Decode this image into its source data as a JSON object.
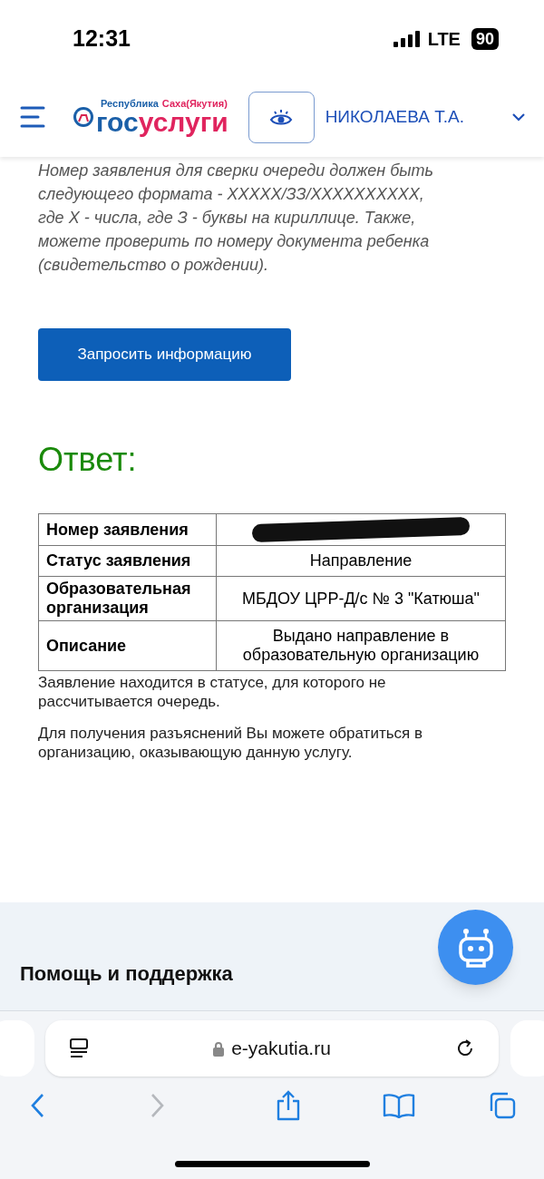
{
  "status_bar": {
    "time": "12:31",
    "network": "LTE",
    "battery": "90"
  },
  "header": {
    "brand_top_left": "Республика",
    "brand_top_right": "Саха(Якутия)",
    "brand_left": "гос",
    "brand_right": "услуги",
    "user": "НИКОЛАЕВА Т.А."
  },
  "hint": "Номер заявления для сверки очереди должен быть следующего формата - XXXXX/ЗЗ/XXXXXXXXXX, где X - числа, где З - буквы на кириллице. Также, можете проверить по номеру документа ребенка (свидетельство о рождении).",
  "request_button": "Запросить информацию",
  "answer_title": "Ответ:",
  "table": {
    "rows": [
      {
        "label": "Номер заявления",
        "redacted": true
      },
      {
        "label": "Статус заявления",
        "value": "Направление"
      },
      {
        "label": "Образовательная организация",
        "value": "МБДОУ ЦРР-Д/с № 3 \"Катюша\""
      },
      {
        "label": "Описание",
        "value": "Выдано направление в образовательную организацию"
      }
    ]
  },
  "notes": [
    "Заявление находится в статусе, для которого не рассчитывается очередь.",
    "Для получения разъяснений Вы можете обратиться в организацию, оказывающую данную услугу."
  ],
  "footer": {
    "title": "Помощь и поддержка"
  },
  "browser": {
    "url": "e-yakutia.ru",
    "back_disabled": false,
    "forward_disabled": true
  }
}
